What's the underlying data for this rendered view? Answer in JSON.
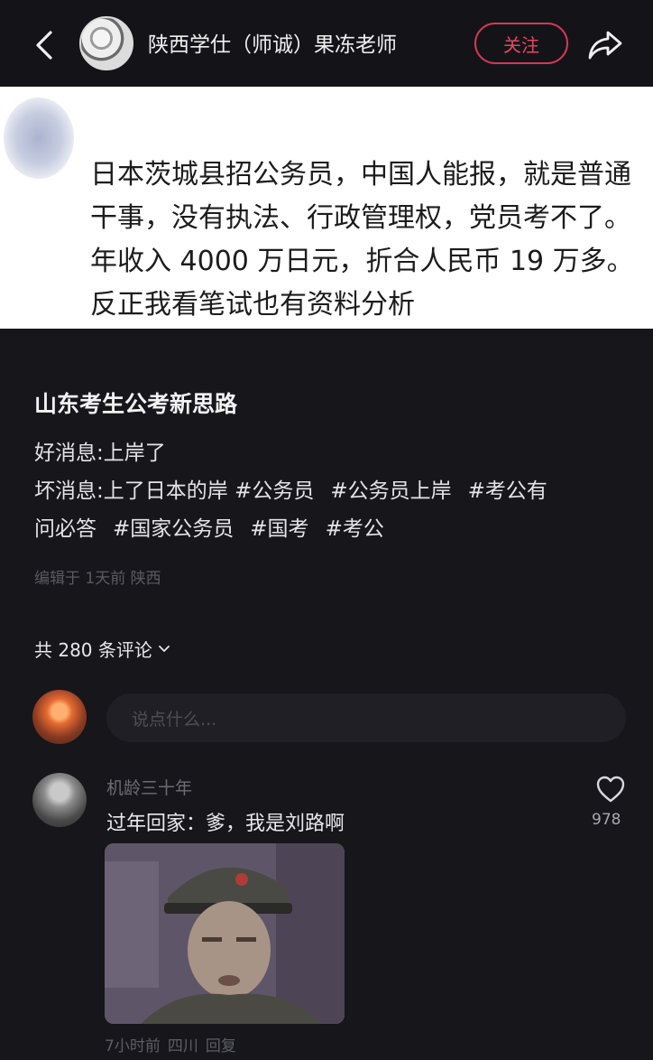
{
  "header": {
    "author_name": "陕西学仕（师诚）果冻老师",
    "follow_label": "关注"
  },
  "image_text": "日本茨城县招公务员，中国人能报，就是普通干事，没有执法、行政管理权，党员考不了。年收入 4000 万日元，折合人民币 19 万多。反正我看笔试也有资料分析",
  "post": {
    "title": "山东考生公考新思路",
    "line1": "好消息:上岸了",
    "line2_prefix": "坏消息:上了日本的岸 ",
    "tags": [
      "#公务员",
      "#公务员上岸",
      "#考公有",
      "问必答",
      "#国家公务员",
      "#国考",
      "#考公"
    ],
    "meta": "编辑于 1天前 陕西"
  },
  "comments_header": {
    "count_label": "共 280 条评论"
  },
  "comment_input": {
    "placeholder": "说点什么..."
  },
  "comment": {
    "name": "机龄三十年",
    "text": "过年回家：爹，我是刘路啊",
    "likes": "978",
    "time": "7小时前",
    "location": "四川",
    "reply_label": "回复"
  },
  "colors": {
    "accent": "#e64665",
    "background": "#16161b",
    "muted": "#5a5a62"
  }
}
